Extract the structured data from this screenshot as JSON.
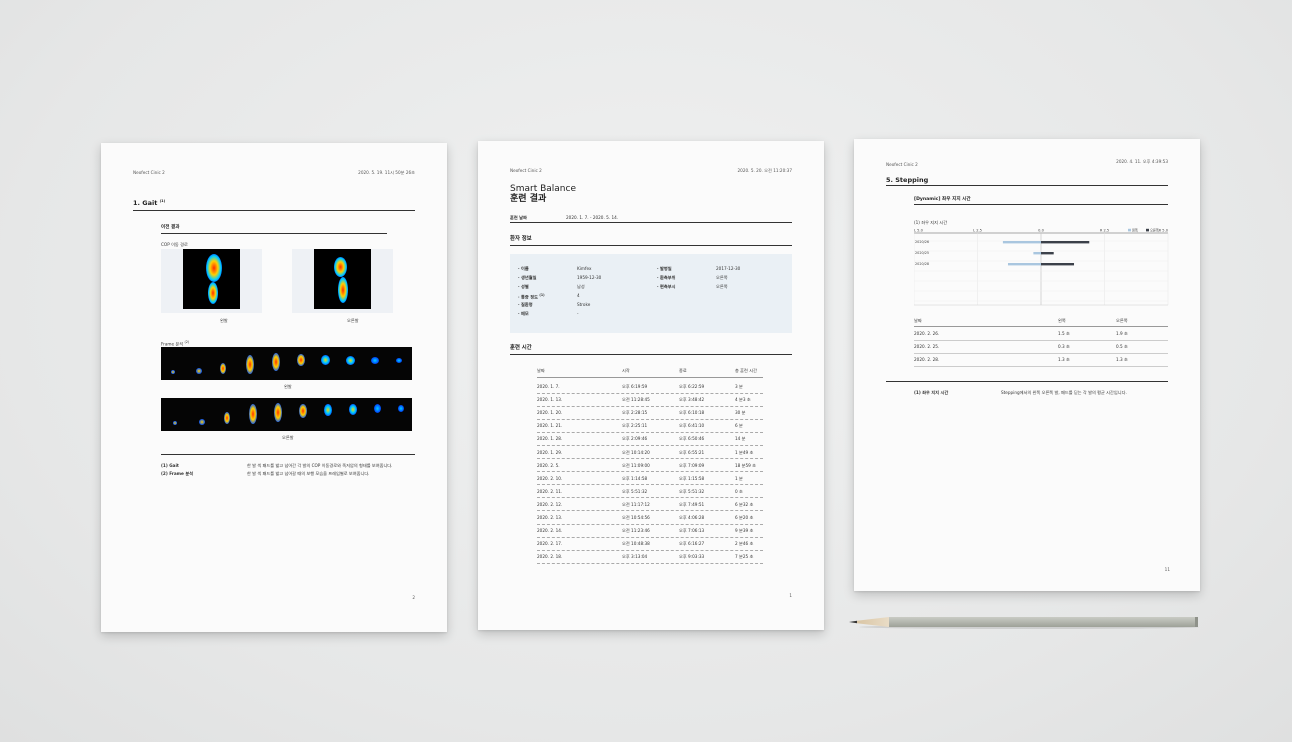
{
  "brand": "Neofect Cinic 2",
  "sheet1": {
    "header_date": "2020. 5. 19. 11시 50분 26초",
    "section_title": "1. Gait",
    "section_sup": "(1)",
    "sub_title": "이전 결과",
    "cop_label": "COP 이동 경로",
    "left_label": "왼발",
    "right_label": "오른발",
    "frame_label": "Frame 분석",
    "frame_sup": "(2)",
    "strip_left_label": "왼발",
    "strip_right_label": "오른발",
    "notes": [
      {
        "key": "(1) Gait",
        "text": "한 발 씩 패드를 밟고 넘어간 각 발의 COP 이동경로와 족저압의 형태를 보여줍니다."
      },
      {
        "key": "(2) Frame 분석",
        "text": "한 발 씩 패드를 밟고 넘어갈 때의 보행 모습을 프레임별로 보여줍니다."
      }
    ],
    "page_number": "2"
  },
  "sheet2": {
    "header_date": "2020. 5. 20. 오전 11:20:37",
    "title_en": "Smart Balance",
    "title_ko": "훈련 결과",
    "period_label": "훈련 날짜",
    "period_value": "2020. 1. 7. - 2020. 5. 14.",
    "patient_section": "환자 정보",
    "patient_left": [
      {
        "label": "· 이름",
        "value": "Kimfex"
      },
      {
        "label": "· 생년월일",
        "value": "1959-12-30"
      },
      {
        "label": "· 성별",
        "value": "남성"
      },
      {
        "label": "· 통증 정도",
        "sup": "(1)",
        "value": "4"
      },
      {
        "label": "· 질환명",
        "value": "Stroke"
      },
      {
        "label": "· 메모",
        "value": "-"
      }
    ],
    "patient_right": [
      {
        "label": "· 발병일",
        "value": "2017-12-30"
      },
      {
        "label": "· 환측부위",
        "value": "오른쪽"
      },
      {
        "label": "· 편측부시",
        "value": "오른쪽"
      }
    ],
    "training_section": "훈련 시간",
    "columns": [
      "날짜",
      "시작",
      "종료",
      "총 훈련 시간"
    ],
    "rows": [
      [
        "2020. 1. 7.",
        "오후 6:19:59",
        "오후 6:22:59",
        "3 분"
      ],
      [
        "2020. 1. 13.",
        "오전 11:28:45",
        "오후 3:48:42",
        "4 분3 초"
      ],
      [
        "2020. 1. 20.",
        "오후 2:28:15",
        "오후 6:10:18",
        "30 분"
      ],
      [
        "2020. 1. 21.",
        "오후 2:25:11",
        "오후 6:41:10",
        "6 분"
      ],
      [
        "2020. 1. 28.",
        "오후 2:09:46",
        "오후 6:50:46",
        "14 분"
      ],
      [
        "2020. 1. 29.",
        "오전 10:14:20",
        "오후 6:55:21",
        "1 분49 초"
      ],
      [
        "2020. 2. 5.",
        "오전 11:09:00",
        "오후 7:09:09",
        "18 분59 초"
      ],
      [
        "2020. 2. 10.",
        "오후 1:14:58",
        "오후 1:15:58",
        "1 분"
      ],
      [
        "2020. 2. 11.",
        "오후 5:51:32",
        "오후 5:51:32",
        "0 초"
      ],
      [
        "2020. 2. 12.",
        "오전 11:17:12",
        "오후 7:49:51",
        "6 분32 초"
      ],
      [
        "2020. 2. 13.",
        "오전 10:54:56",
        "오후 4:06:28",
        "6 분20 초"
      ],
      [
        "2020. 2. 14.",
        "오전 11:23:46",
        "오후 7:06:13",
        "9 분39 초"
      ],
      [
        "2020. 2. 17.",
        "오전 10:48:38",
        "오후 6:16:27",
        "2 분46 초"
      ],
      [
        "2020. 2. 18.",
        "오후 3:13:04",
        "오후 9:03:33",
        "7 분25 초"
      ]
    ],
    "page_number": "1"
  },
  "sheet3": {
    "header_date": "2020. 4. 11. 오후 4:39:53",
    "section_title": "5. Stepping",
    "sub_title": "[Dynamic] 좌우 지지 시간",
    "chart_label": "(1) 좌우 지지 시간",
    "chart_sup": "(1)",
    "page_number": "11",
    "columns": [
      "날짜",
      "왼쪽",
      "오른쪽"
    ],
    "rows": [
      [
        "2020. 2. 26.",
        "1.5 초",
        "1.9 초"
      ],
      [
        "2020. 2. 25.",
        "0.3 초",
        "0.5 초"
      ],
      [
        "2020. 2. 28.",
        "1.3 초",
        "1.3 초"
      ]
    ],
    "note_key": "(1) 좌우 지지 시간",
    "note_text": "Stepping에서의 왼쪽 오른쪽 발, 패드를 딛는 각 발의 평균 시간입니다."
  },
  "chart_data": {
    "type": "bar",
    "categories": [
      "2020/26",
      "2020/25",
      "2020/28"
    ],
    "series": [
      {
        "name": "왼쪽",
        "values": [
          -1.5,
          -0.3,
          -1.3
        ],
        "color": "#a9c6df"
      },
      {
        "name": "오른쪽",
        "values": [
          1.9,
          0.5,
          1.3
        ],
        "color": "#3c414a"
      }
    ],
    "xticks": [
      "L 5.0",
      "L 2.5",
      "0.0",
      "R 2.5",
      "R 5.0"
    ],
    "xlim": [
      -5,
      5
    ],
    "legend": "top-right",
    "orientation": "horizontal"
  }
}
